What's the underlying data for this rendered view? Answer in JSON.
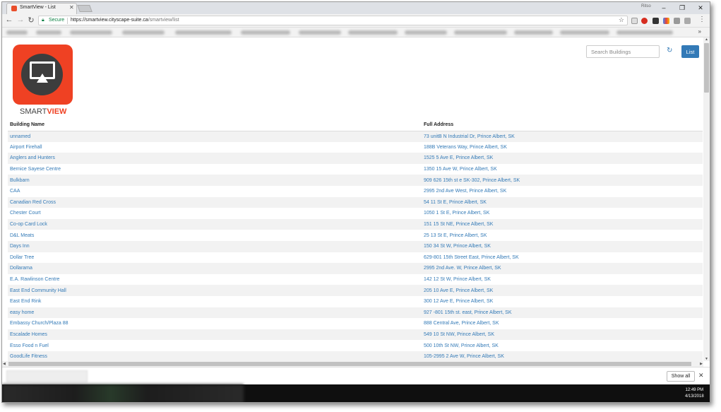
{
  "browser": {
    "tab_title": "SmartView - List",
    "tab_close": "✕",
    "user_chip": "Ritso",
    "window_controls": {
      "minimize": "–",
      "maximize": "❐",
      "close": "✕"
    },
    "nav": {
      "back": "←",
      "forward": "→",
      "reload": "↻"
    },
    "secure_label": "Secure",
    "url_host": "https://smartview.cityscape-suite.ca",
    "url_path": "/smartview/list",
    "star": "☆",
    "bookmarks_more": "»"
  },
  "header": {
    "logo_text_part1": "SMART",
    "logo_text_part2": "VIEW",
    "search_placeholder": "Search Buildings",
    "refresh_icon": "↻",
    "list_button": "List"
  },
  "table": {
    "columns": [
      "Building Name",
      "Full Address"
    ],
    "rows": [
      [
        "unnamed",
        "73 unitB N Industrial Dr, Prince Albert, SK"
      ],
      [
        "Airport Firehall",
        "188B Veterans Way, Prince Albert, SK"
      ],
      [
        "Anglers and Hunters",
        "1525 5 Ave E, Prince Albert, SK"
      ],
      [
        "Bernice Sayese Centre",
        "1350 15 Ave W, Prince Albert, SK"
      ],
      [
        "Bulkbarn",
        "909 626 15th st e SK-302, Prince Albert, SK"
      ],
      [
        "CAA",
        "2995 2nd Ave West, Prince Albert, SK"
      ],
      [
        "Canadian Red Cross",
        "54 11 St E, Prince Albert, SK"
      ],
      [
        "Chester Court",
        "1050 1 St E, Prince Albert, SK"
      ],
      [
        "Co-op Card Lock",
        "151 15 St NE, Prince Albert, SK"
      ],
      [
        "D&L Meats",
        "25 13 St E, Prince Albert, SK"
      ],
      [
        "Days Inn",
        "150 34 St W, Prince Albert, SK"
      ],
      [
        "Dollar Tree",
        "629-801 15th Street East, Prince Albert, SK"
      ],
      [
        "Dollarama",
        "2995 2nd Ave. W, Prince Albert, SK"
      ],
      [
        "E.A. Rawlinson Centre",
        "142 12 St W, Prince Albert, SK"
      ],
      [
        "East End Community Hall",
        "205 10 Ave E, Prince Albert, SK"
      ],
      [
        "East End Rink",
        "300 12 Ave E, Prince Albert, SK"
      ],
      [
        "easy home",
        "927 -801 15th st. east, Prince Albert, SK"
      ],
      [
        "Embassy Church/Plaza 88",
        "888 Central Ave, Prince Albert, SK"
      ],
      [
        "Escalade Homes",
        "549 10 St NW, Prince Albert, SK"
      ],
      [
        "Esso Food n Fuel",
        "500 10th St NW, Prince Albert, SK"
      ],
      [
        "GoodLife Fitness",
        "105-2995 2 Ave W, Prince Albert, SK"
      ]
    ]
  },
  "downloads": {
    "show_all": "Show all",
    "close": "✕"
  },
  "taskbar": {
    "time": "12:49 PM",
    "date": "4/13/2018"
  },
  "colors": {
    "link": "#337ab7",
    "brand": "#ef4123",
    "button": "#337ab7"
  }
}
